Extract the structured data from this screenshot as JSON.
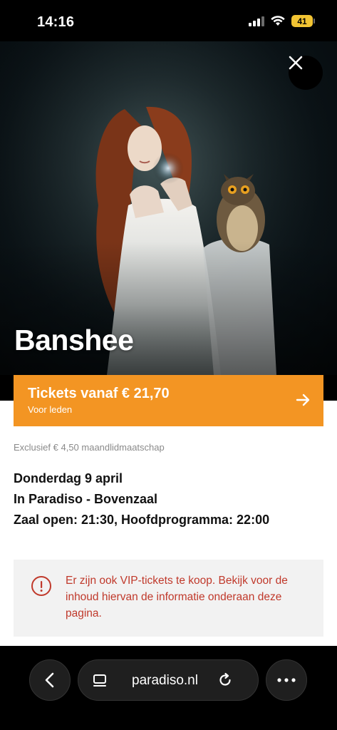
{
  "status_bar": {
    "time": "14:16",
    "battery": "41"
  },
  "hero": {
    "title": "Banshee",
    "image": "woman-with-owl-photo"
  },
  "ticket": {
    "label": "Tickets vanaf € 21,70",
    "sublabel": "Voor leden"
  },
  "exclusief": "Exclusief € 4,50 maandlidmaatschap",
  "event": {
    "date": "Donderdag 9 april",
    "venue": "In Paradiso - Bovenzaal",
    "times": "Zaal open: 21:30, Hoofdprogramma: 22:00"
  },
  "notice": {
    "text": "Er zijn ook VIP-tickets te koop. Bekijk voor de inhoud hiervan de informatie onderaan deze pagina."
  },
  "browser": {
    "url": "paradiso.nl"
  },
  "colors": {
    "accent": "#f39523",
    "notice_text": "#c0392b",
    "notice_bg": "#f2f2f2"
  }
}
